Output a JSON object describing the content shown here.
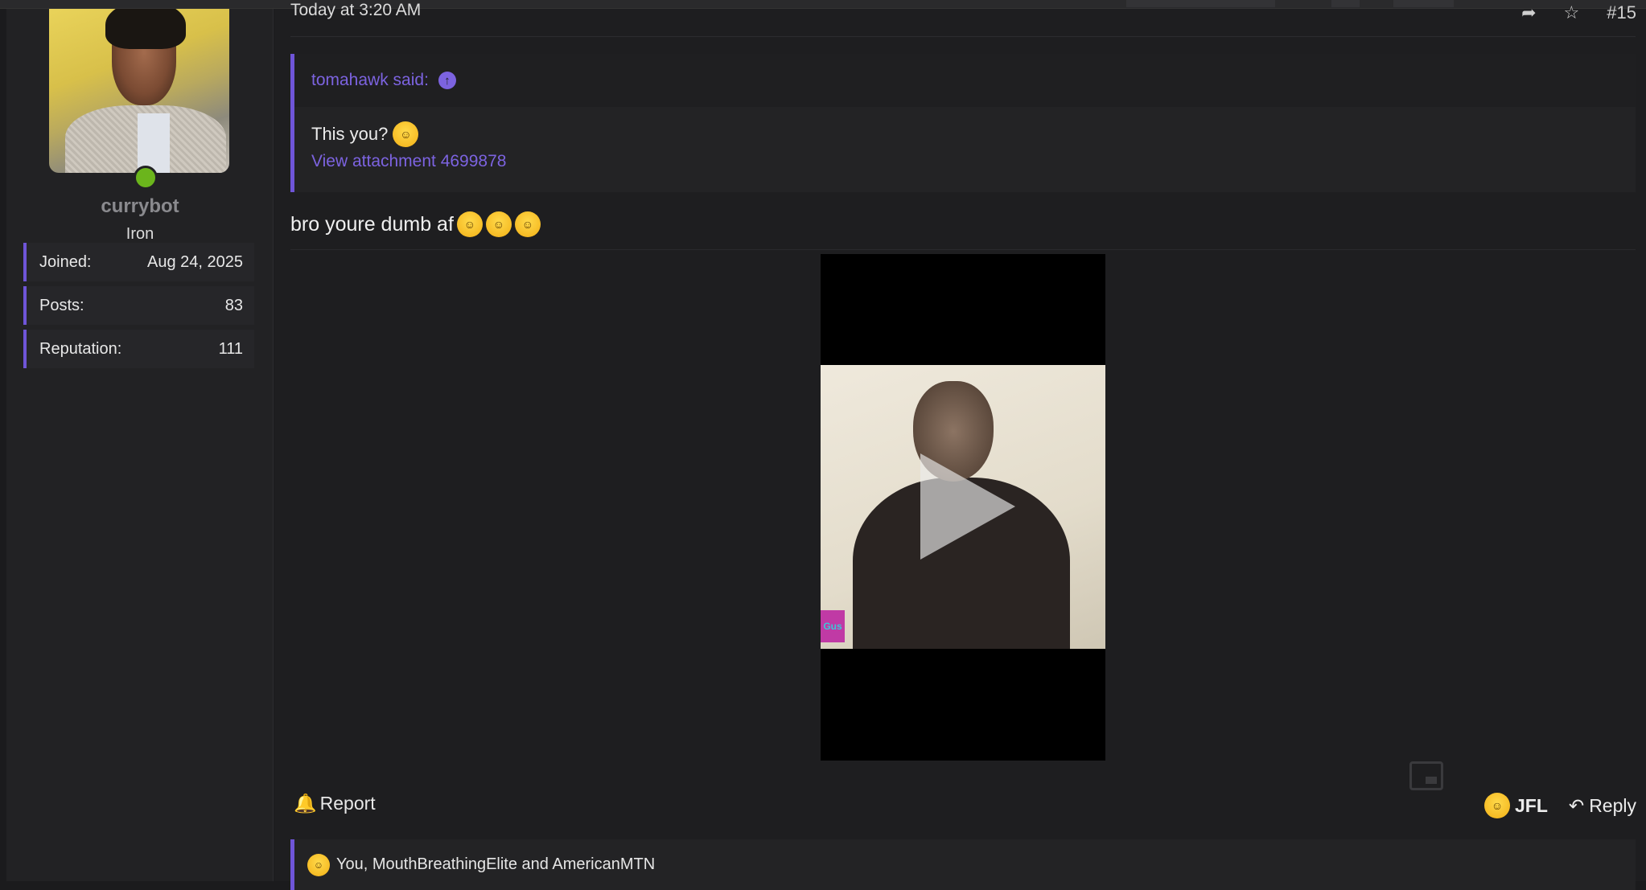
{
  "post": {
    "timestamp": "Today at 3:20 AM",
    "post_number": "#15"
  },
  "user": {
    "username": "currybot",
    "rank": "Iron",
    "stats": [
      {
        "label": "Joined:",
        "value": "Aug 24, 2025"
      },
      {
        "label": "Posts:",
        "value": "83"
      },
      {
        "label": "Reputation:",
        "value": "111"
      }
    ]
  },
  "quote": {
    "author": "tomahawk said:",
    "text": "This you?",
    "attachment_link": "View attachment 4699878"
  },
  "message": {
    "text": "bro youre dumb af"
  },
  "actions": {
    "report": "Report",
    "jfl": "JFL",
    "reply": "Reply"
  },
  "reactions": {
    "text": "You, MouthBreathingElite and AmericanMTN"
  },
  "colors": {
    "accent": "#6f55d8",
    "link": "#7c63e0",
    "online": "#6bb51c"
  }
}
